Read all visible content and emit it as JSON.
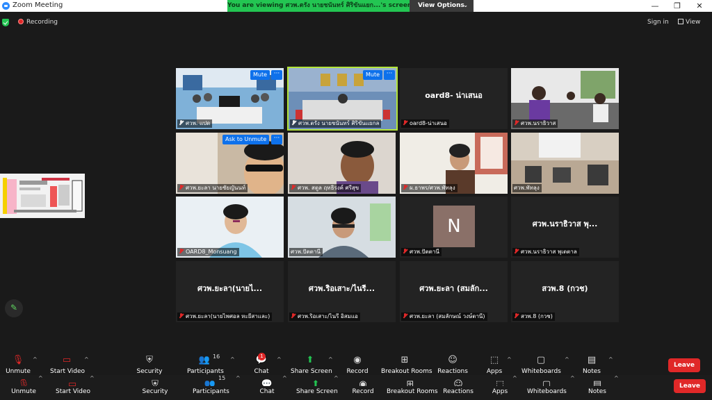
{
  "window": {
    "title": "Zoom Meeting",
    "minimize": "—",
    "restore": "❐",
    "close": "✕"
  },
  "banner": {
    "text": "You are viewing ศวพ.ตรัง นายชนันทร์ ศิริขันแยก...'s screen",
    "view_options": "View Options"
  },
  "status": {
    "recording": "Recording",
    "sign_in": "Sign in",
    "view": "View"
  },
  "tiles": [
    {
      "label": "ศวพ. แปด",
      "mute": "Mute",
      "more": "···"
    },
    {
      "label": "ศวพ.ตรัง นายชนันทร์ ศิริขันแยกล",
      "mute": "Mute",
      "more": "···"
    },
    {
      "name": "oard8- น่าเสนอ",
      "label": "oard8-น่าเสนอ"
    },
    {
      "label": "ศวพ.นราธิวาส"
    },
    {
      "label": "ศวพ.ยะลา นายชัยญันนท์",
      "ask": "Ask to Unmute",
      "more": "···"
    },
    {
      "label": "ศวพ. สตูล ฤทธิรงค์ ศรีสุข"
    },
    {
      "label": "ผ.ธาพร/ศวพ.พัทลุง"
    },
    {
      "label": "ศวพ.พัทลุง"
    },
    {
      "label": "OARD8_Monsuang"
    },
    {
      "label": "ศวพ.ปัตตานี"
    },
    {
      "avatar": "N",
      "label": "ศวพ.ปัตตานี"
    },
    {
      "name": "ศวพ.นราธิวาส พุ...",
      "label": "ศวพ.นราธิวาส พุเตตาล"
    },
    {
      "name": "ศวพ.ยะลา(นายไ...",
      "label": "ศวพ.ยะลา(นายไพศอล หะยีสาและ)"
    },
    {
      "name": "ศวพ.ริอเสาะ/ไนรี...",
      "label": "ศวพ.ริอเสาะ/ไนรี อิสมแอ"
    },
    {
      "name": "ศวพ.ยะลา (สมลัก...",
      "label": "ศวพ.ยะลา (สมลักษณ์ วงษ์ตานี)"
    },
    {
      "name": "สวพ.8 (กวช)",
      "label": "สวพ.8 (กวช)"
    }
  ],
  "toolbar": {
    "unmute": "Unmute",
    "start_video": "Start Video",
    "security": "Security",
    "participants": "Participants",
    "participants_count": "16",
    "participants_count_2": "15",
    "chat": "Chat",
    "chat_badge": "1",
    "share_screen": "Share Screen",
    "record": "Record",
    "breakout_rooms": "Breakout Rooms",
    "reactions": "Reactions",
    "apps": "Apps",
    "whiteboards": "Whiteboards",
    "notes": "Notes",
    "leave": "Leave"
  },
  "colors": {
    "accent": "#0e71eb",
    "share": "#23c552",
    "leave": "#e02828",
    "highlight": "#b3e43a"
  }
}
